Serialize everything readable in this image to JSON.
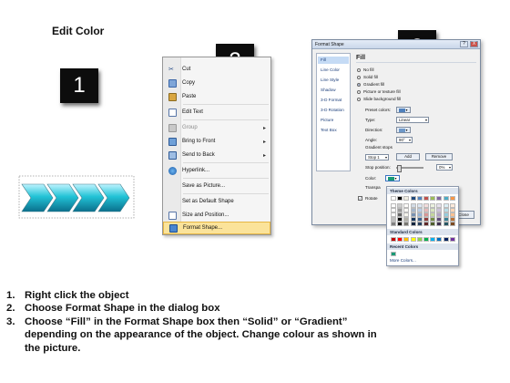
{
  "slide": {
    "title": "Edit Color",
    "step_badges": [
      "1",
      "2",
      "3"
    ]
  },
  "context_menu": {
    "items": [
      {
        "label": "Cut",
        "icon": "scissors-icon",
        "enabled": true,
        "submenu": false
      },
      {
        "label": "Copy",
        "icon": "copy-icon",
        "enabled": true,
        "submenu": false
      },
      {
        "label": "Paste",
        "icon": "paste-icon",
        "enabled": true,
        "submenu": false
      },
      {
        "label": "Edit Text",
        "icon": "edit-text-icon",
        "enabled": true,
        "submenu": false
      },
      {
        "label": "Group",
        "icon": "group-icon",
        "enabled": false,
        "submenu": true
      },
      {
        "label": "Bring to Front",
        "icon": "bring-front-icon",
        "enabled": true,
        "submenu": true
      },
      {
        "label": "Send to Back",
        "icon": "send-back-icon",
        "enabled": true,
        "submenu": true
      },
      {
        "label": "Hyperlink...",
        "icon": "hyperlink-icon",
        "enabled": true,
        "submenu": false
      },
      {
        "label": "Save as Picture...",
        "icon": "",
        "enabled": true,
        "submenu": false
      },
      {
        "label": "Set as Default Shape",
        "icon": "",
        "enabled": true,
        "submenu": false
      },
      {
        "label": "Size and Position...",
        "icon": "size-position-icon",
        "enabled": true,
        "submenu": false
      },
      {
        "label": "Format Shape...",
        "icon": "format-shape-icon",
        "enabled": true,
        "submenu": false,
        "highlighted": true
      }
    ]
  },
  "format_dialog": {
    "title": "Format Shape",
    "help": "?",
    "close_x": "X",
    "nav": [
      "Fill",
      "Line Color",
      "Line Style",
      "Shadow",
      "3-D Format",
      "3-D Rotation",
      "Picture",
      "Text Box"
    ],
    "section_title": "Fill",
    "fill_options": [
      {
        "label": "No fill",
        "selected": false
      },
      {
        "label": "Solid fill",
        "selected": false
      },
      {
        "label": "Gradient fill",
        "selected": true
      },
      {
        "label": "Picture or texture fill",
        "selected": false
      },
      {
        "label": "Slide background fill",
        "selected": false
      }
    ],
    "preset_colors_label": "Preset colors:",
    "type_label": "Type:",
    "type_value": "Linear",
    "direction_label": "Direction:",
    "angle_label": "Angle:",
    "angle_value": "90°",
    "gradient_stops_label": "Gradient stops",
    "stop_value": "Stop 1",
    "add_label": "Add",
    "remove_label": "Remove",
    "stop_position_label": "Stop position:",
    "stop_position_value": "0%",
    "color_label": "Color:",
    "transparency_label": "Transpa",
    "rotate_label": "Rotate",
    "close_label": "Close"
  },
  "color_palette": {
    "theme_header": "Theme Colors",
    "standard_header": "Standard Colors",
    "recent_header": "Recent Colors",
    "more_colors": "More Colors...",
    "theme_top": [
      "#ffffff",
      "#000000",
      "#eeece1",
      "#1f497d",
      "#4f81bd",
      "#c0504d",
      "#9bbb59",
      "#8064a2",
      "#4bacc6",
      "#f79646"
    ],
    "standard": [
      "#c00000",
      "#ff0000",
      "#ffc000",
      "#ffff00",
      "#92d050",
      "#00b050",
      "#00b0f0",
      "#0070c0",
      "#002060",
      "#7030a0"
    ],
    "recent": [
      "#1a9a76"
    ]
  },
  "steps": [
    {
      "num": "1.",
      "text": "Right click the object"
    },
    {
      "num": "2.",
      "text": "Choose Format Shape in the dialog box"
    },
    {
      "num": "3.",
      "text": "Choose “Fill” in the Format Shape box then “Solid” or “Gradient” depending on the appearance of the object. Change colour as shown in the picture."
    }
  ]
}
